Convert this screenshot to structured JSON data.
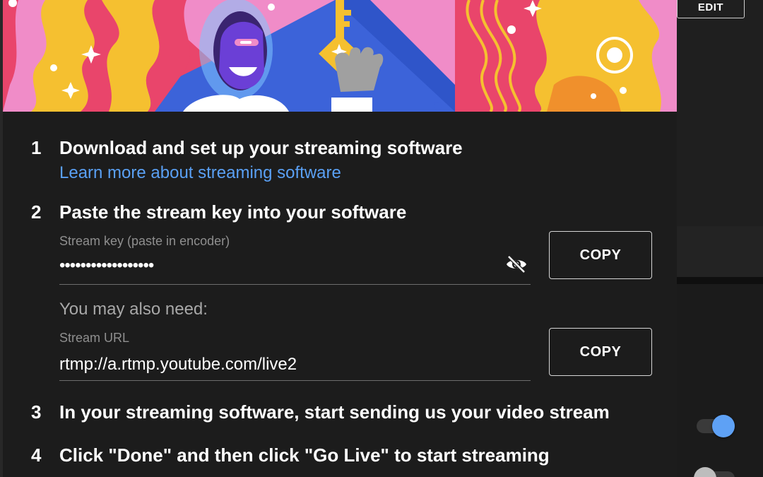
{
  "background": {
    "edit_button": "EDIT"
  },
  "dialog": {
    "steps": [
      {
        "number": "1",
        "title": "Download and set up your streaming software",
        "link": "Learn more about streaming software"
      },
      {
        "number": "2",
        "title": "Paste the stream key into your software"
      },
      {
        "number": "3",
        "title": "In your streaming software, start sending us your video stream"
      },
      {
        "number": "4",
        "title": "Click \"Done\" and then click \"Go Live\" to start streaming"
      }
    ],
    "stream_key": {
      "label": "Stream key (paste in encoder)",
      "value": "••••••••••••••••••",
      "visibility_icon": "eye-off-icon",
      "copy_label": "COPY"
    },
    "also_need": "You may also need:",
    "stream_url": {
      "label": "Stream URL",
      "value": "rtmp://a.rtmp.youtube.com/live2",
      "copy_label": "COPY"
    }
  },
  "colors": {
    "link": "#5aa0f4",
    "toggle_on": "#5ea1f5",
    "dialog_bg": "#1c1c1c"
  },
  "toggles": [
    {
      "state": "on"
    },
    {
      "state": "off"
    }
  ]
}
